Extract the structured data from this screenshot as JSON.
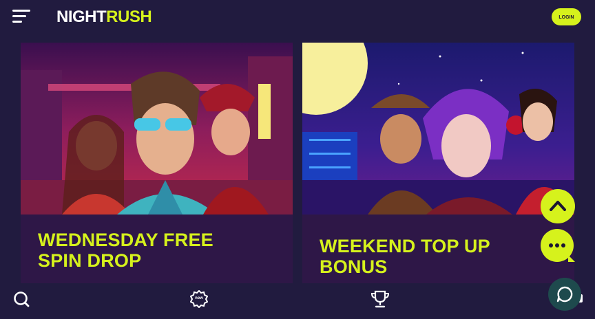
{
  "header": {
    "logo_part1": "NIGHT",
    "logo_part2": "RUSH",
    "login_label": "LOGIN"
  },
  "promotions": [
    {
      "title_line1": "WEDNESDAY FREE",
      "title_line2": "SPIN DROP"
    },
    {
      "title_line1": "WEEKEND TOP UP",
      "title_line2": "BONUS"
    }
  ],
  "bottom_nav": {
    "new_badge": "new"
  },
  "colors": {
    "background": "#211b3f",
    "accent": "#d6f21c",
    "card_bg": "#2e1747",
    "support": "#1e4a4d"
  },
  "icons": [
    "menu-icon",
    "chevron-up-icon",
    "chat-dots-icon",
    "search-icon",
    "new-games-icon",
    "trophy-icon",
    "support-chat-icon"
  ]
}
